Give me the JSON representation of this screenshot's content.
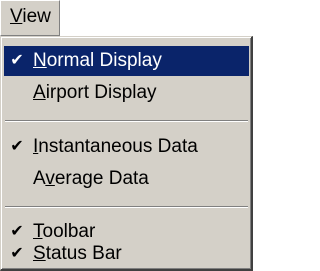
{
  "menubar": {
    "view_label": "View",
    "view_mnemonic": "V",
    "view_rest": "iew"
  },
  "menu": {
    "items": [
      {
        "checked": true,
        "mnemonic": "N",
        "rest": "ormal Display",
        "highlighted": true
      },
      {
        "checked": false,
        "mnemonic": "A",
        "rest": "irport Display",
        "highlighted": false
      },
      {
        "checked": true,
        "mnemonic": "I",
        "rest": "nstantaneous Data",
        "highlighted": false
      },
      {
        "checked": false,
        "pre": "A",
        "mnemonic": "v",
        "rest": "erage Data",
        "highlighted": false
      },
      {
        "checked": true,
        "mnemonic": "T",
        "rest": "oolbar",
        "highlighted": false
      },
      {
        "checked": true,
        "mnemonic": "S",
        "rest": "tatus Bar",
        "highlighted": false
      }
    ],
    "check_glyph": "✔"
  },
  "colors": {
    "menu_bg": "#d4d0c8",
    "highlight_bg": "#0a246a",
    "highlight_text": "#ffffff"
  }
}
